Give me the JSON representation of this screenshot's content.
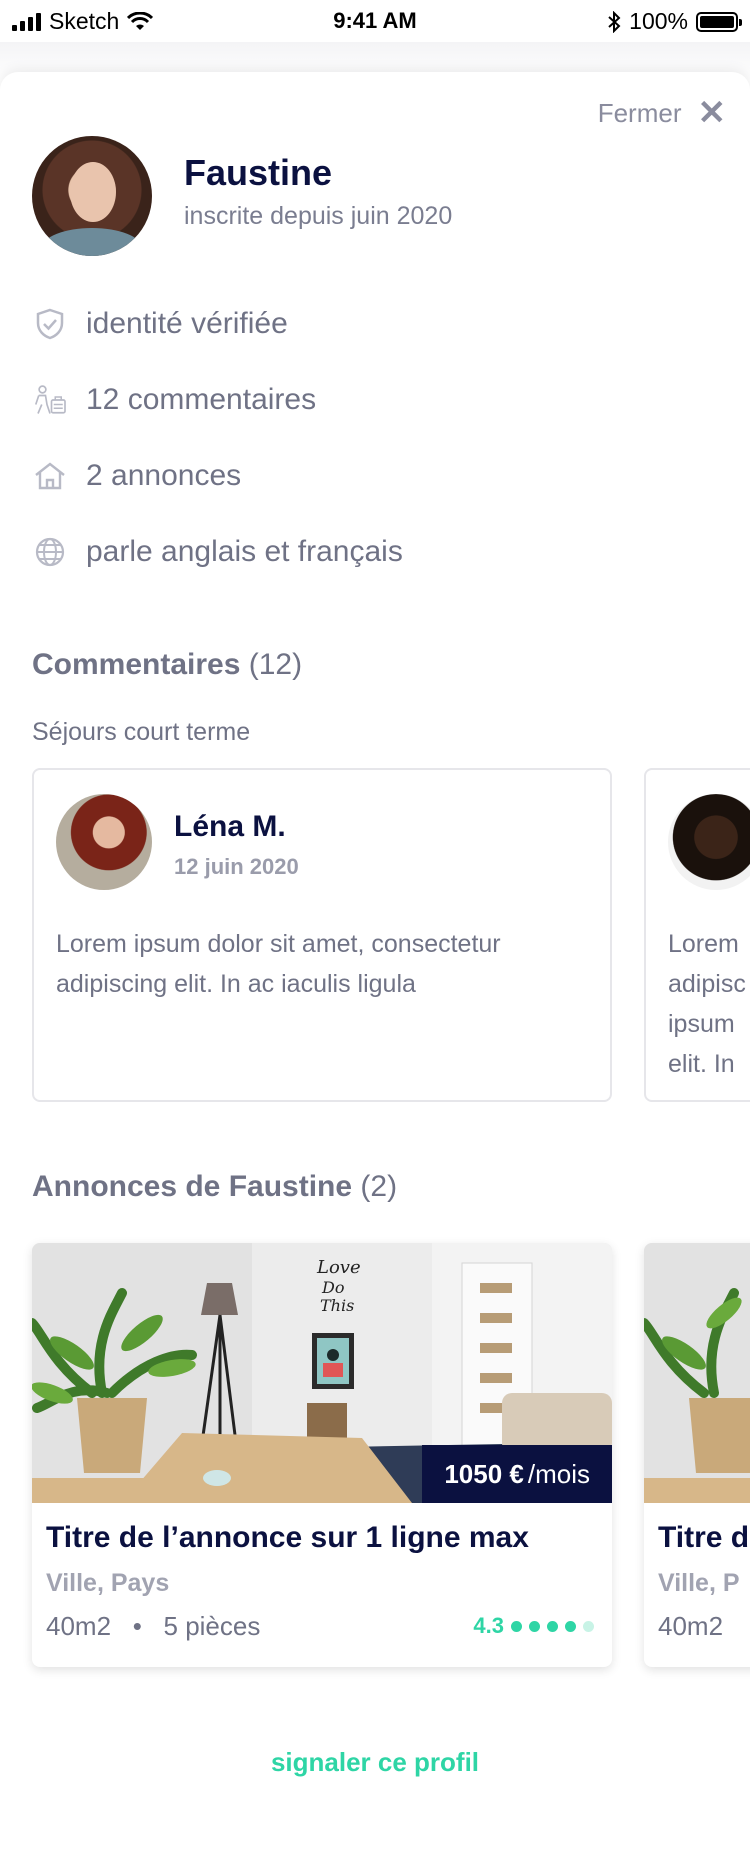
{
  "status_bar": {
    "carrier": "Sketch",
    "time": "9:41 AM",
    "battery": "100%"
  },
  "close": {
    "label": "Fermer"
  },
  "profile": {
    "name": "Faustine",
    "member_since": "inscrite depuis juin 2020"
  },
  "info": [
    {
      "icon": "shield-check-icon",
      "text": "identité vérifiée"
    },
    {
      "icon": "traveler-luggage-icon",
      "text": "12 commentaires"
    },
    {
      "icon": "house-icon",
      "text": "2 annonces"
    },
    {
      "icon": "globe-icon",
      "text": "parle anglais et français"
    }
  ],
  "comments": {
    "title": "Commentaires",
    "count": "(12)",
    "subtitle": "Séjours court terme",
    "items": [
      {
        "author": "Léna M.",
        "date": "12 juin 2020",
        "text": "Lorem ipsum dolor sit amet, consectetur adipiscing elit. In ac iaculis ligula"
      },
      {
        "author": "",
        "date": "",
        "text": "Lorem adipisc ipsum elit. In"
      }
    ]
  },
  "listings": {
    "title": "Annonces de Faustine",
    "count": "(2)",
    "items": [
      {
        "price": "1050 €",
        "unit": "/mois",
        "title": "Titre de l’annonce sur 1 ligne max",
        "location": "Ville, Pays",
        "surface": "40m2",
        "rooms": "5 pièces",
        "rating": "4.3",
        "rating_value": 4.3
      },
      {
        "title": "Titre d",
        "location": "Ville, P",
        "surface": "40m2"
      }
    ]
  },
  "report": {
    "label": "signaler ce profil"
  },
  "colors": {
    "navy": "#0b1140",
    "accent": "#2ed5a5",
    "muted": "#6f7285"
  }
}
